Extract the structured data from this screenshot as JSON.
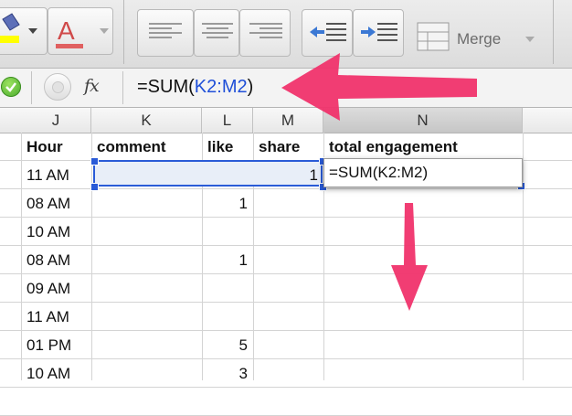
{
  "toolbar": {
    "merge_label": "Merge",
    "icons": [
      "fill-color-icon",
      "font-color-icon",
      "align-left-icon",
      "align-center-icon",
      "align-right-icon",
      "decrease-indent-icon",
      "increase-indent-icon",
      "merge-cells-icon"
    ]
  },
  "formula_bar": {
    "fx_label": "fx",
    "formula_prefix": "=SUM(",
    "formula_ref": "K2:M2",
    "formula_suffix": ")"
  },
  "sheet": {
    "columns": [
      "J",
      "K",
      "L",
      "M",
      "N"
    ],
    "active_column": "N",
    "header_row": [
      "Hour",
      "comment",
      "like",
      "share",
      "total engagement"
    ],
    "rows": [
      {
        "hour": "11 AM",
        "comment": "",
        "like": "",
        "share": "1",
        "total": "=SUM(K2:M2)"
      },
      {
        "hour": "08 AM",
        "comment": "",
        "like": "1",
        "share": "",
        "total": ""
      },
      {
        "hour": "10 AM",
        "comment": "",
        "like": "",
        "share": "",
        "total": ""
      },
      {
        "hour": "08 AM",
        "comment": "",
        "like": "1",
        "share": "",
        "total": ""
      },
      {
        "hour": "09 AM",
        "comment": "",
        "like": "",
        "share": "",
        "total": ""
      },
      {
        "hour": "11 AM",
        "comment": "",
        "like": "",
        "share": "",
        "total": ""
      },
      {
        "hour": "01 PM",
        "comment": "",
        "like": "5",
        "share": "",
        "total": ""
      },
      {
        "hour": "10 AM",
        "comment": "",
        "like": "3",
        "share": "",
        "total": ""
      }
    ]
  },
  "colors": {
    "selection": "#2a5bd7",
    "annotation_arrow": "#f0336b",
    "reference_text": "#1f4fd8"
  }
}
